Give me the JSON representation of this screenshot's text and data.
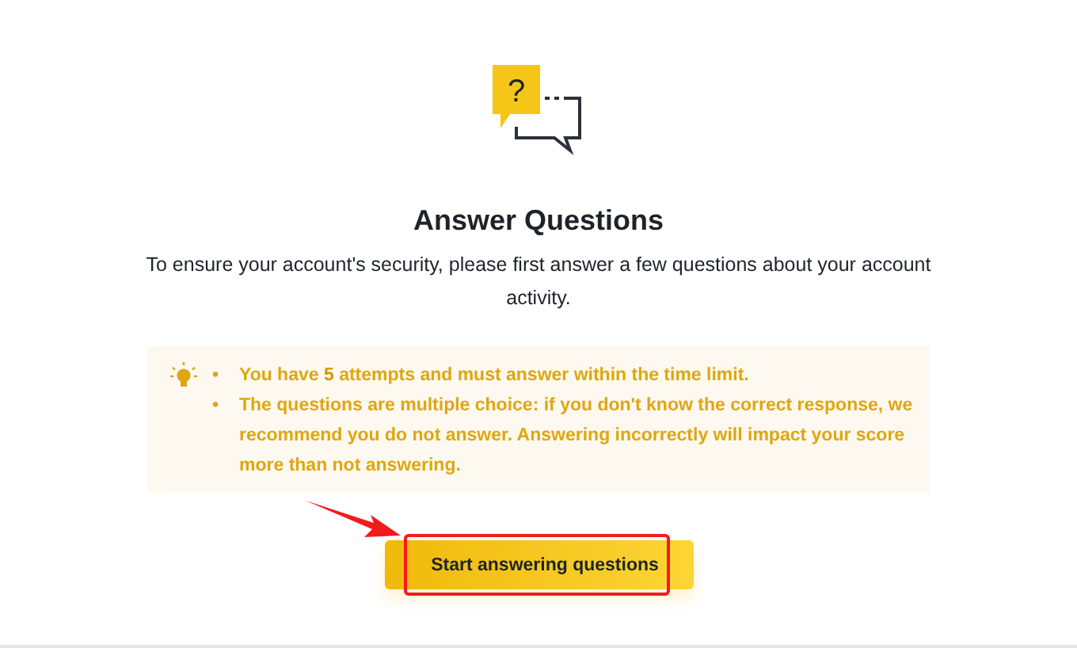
{
  "icon": {
    "glyph": "?"
  },
  "title": "Answer Questions",
  "description": "To ensure your account's security, please first answer a few questions about your account activity.",
  "notice": {
    "marker": "•",
    "items": [
      "You have **5** attempts and must answer within the time limit.",
      "The questions are multiple choice: if you don't know the correct response, we recommend you do not answer. Answering incorrectly will impact your score more than not answering."
    ]
  },
  "button": {
    "label": "Start answering questions"
  }
}
